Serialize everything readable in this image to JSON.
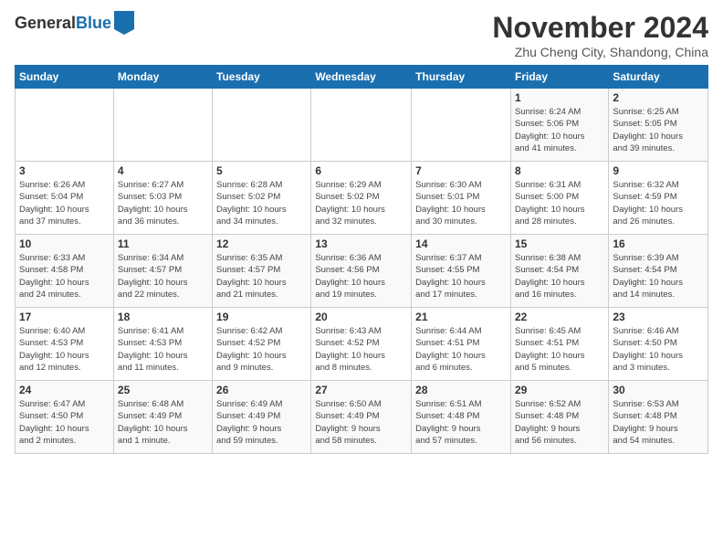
{
  "header": {
    "logo_general": "General",
    "logo_blue": "Blue",
    "month_title": "November 2024",
    "subtitle": "Zhu Cheng City, Shandong, China"
  },
  "days_of_week": [
    "Sunday",
    "Monday",
    "Tuesday",
    "Wednesday",
    "Thursday",
    "Friday",
    "Saturday"
  ],
  "weeks": [
    [
      {
        "day": "",
        "info": ""
      },
      {
        "day": "",
        "info": ""
      },
      {
        "day": "",
        "info": ""
      },
      {
        "day": "",
        "info": ""
      },
      {
        "day": "",
        "info": ""
      },
      {
        "day": "1",
        "info": "Sunrise: 6:24 AM\nSunset: 5:06 PM\nDaylight: 10 hours\nand 41 minutes."
      },
      {
        "day": "2",
        "info": "Sunrise: 6:25 AM\nSunset: 5:05 PM\nDaylight: 10 hours\nand 39 minutes."
      }
    ],
    [
      {
        "day": "3",
        "info": "Sunrise: 6:26 AM\nSunset: 5:04 PM\nDaylight: 10 hours\nand 37 minutes."
      },
      {
        "day": "4",
        "info": "Sunrise: 6:27 AM\nSunset: 5:03 PM\nDaylight: 10 hours\nand 36 minutes."
      },
      {
        "day": "5",
        "info": "Sunrise: 6:28 AM\nSunset: 5:02 PM\nDaylight: 10 hours\nand 34 minutes."
      },
      {
        "day": "6",
        "info": "Sunrise: 6:29 AM\nSunset: 5:02 PM\nDaylight: 10 hours\nand 32 minutes."
      },
      {
        "day": "7",
        "info": "Sunrise: 6:30 AM\nSunset: 5:01 PM\nDaylight: 10 hours\nand 30 minutes."
      },
      {
        "day": "8",
        "info": "Sunrise: 6:31 AM\nSunset: 5:00 PM\nDaylight: 10 hours\nand 28 minutes."
      },
      {
        "day": "9",
        "info": "Sunrise: 6:32 AM\nSunset: 4:59 PM\nDaylight: 10 hours\nand 26 minutes."
      }
    ],
    [
      {
        "day": "10",
        "info": "Sunrise: 6:33 AM\nSunset: 4:58 PM\nDaylight: 10 hours\nand 24 minutes."
      },
      {
        "day": "11",
        "info": "Sunrise: 6:34 AM\nSunset: 4:57 PM\nDaylight: 10 hours\nand 22 minutes."
      },
      {
        "day": "12",
        "info": "Sunrise: 6:35 AM\nSunset: 4:57 PM\nDaylight: 10 hours\nand 21 minutes."
      },
      {
        "day": "13",
        "info": "Sunrise: 6:36 AM\nSunset: 4:56 PM\nDaylight: 10 hours\nand 19 minutes."
      },
      {
        "day": "14",
        "info": "Sunrise: 6:37 AM\nSunset: 4:55 PM\nDaylight: 10 hours\nand 17 minutes."
      },
      {
        "day": "15",
        "info": "Sunrise: 6:38 AM\nSunset: 4:54 PM\nDaylight: 10 hours\nand 16 minutes."
      },
      {
        "day": "16",
        "info": "Sunrise: 6:39 AM\nSunset: 4:54 PM\nDaylight: 10 hours\nand 14 minutes."
      }
    ],
    [
      {
        "day": "17",
        "info": "Sunrise: 6:40 AM\nSunset: 4:53 PM\nDaylight: 10 hours\nand 12 minutes."
      },
      {
        "day": "18",
        "info": "Sunrise: 6:41 AM\nSunset: 4:53 PM\nDaylight: 10 hours\nand 11 minutes."
      },
      {
        "day": "19",
        "info": "Sunrise: 6:42 AM\nSunset: 4:52 PM\nDaylight: 10 hours\nand 9 minutes."
      },
      {
        "day": "20",
        "info": "Sunrise: 6:43 AM\nSunset: 4:52 PM\nDaylight: 10 hours\nand 8 minutes."
      },
      {
        "day": "21",
        "info": "Sunrise: 6:44 AM\nSunset: 4:51 PM\nDaylight: 10 hours\nand 6 minutes."
      },
      {
        "day": "22",
        "info": "Sunrise: 6:45 AM\nSunset: 4:51 PM\nDaylight: 10 hours\nand 5 minutes."
      },
      {
        "day": "23",
        "info": "Sunrise: 6:46 AM\nSunset: 4:50 PM\nDaylight: 10 hours\nand 3 minutes."
      }
    ],
    [
      {
        "day": "24",
        "info": "Sunrise: 6:47 AM\nSunset: 4:50 PM\nDaylight: 10 hours\nand 2 minutes."
      },
      {
        "day": "25",
        "info": "Sunrise: 6:48 AM\nSunset: 4:49 PM\nDaylight: 10 hours\nand 1 minute."
      },
      {
        "day": "26",
        "info": "Sunrise: 6:49 AM\nSunset: 4:49 PM\nDaylight: 9 hours\nand 59 minutes."
      },
      {
        "day": "27",
        "info": "Sunrise: 6:50 AM\nSunset: 4:49 PM\nDaylight: 9 hours\nand 58 minutes."
      },
      {
        "day": "28",
        "info": "Sunrise: 6:51 AM\nSunset: 4:48 PM\nDaylight: 9 hours\nand 57 minutes."
      },
      {
        "day": "29",
        "info": "Sunrise: 6:52 AM\nSunset: 4:48 PM\nDaylight: 9 hours\nand 56 minutes."
      },
      {
        "day": "30",
        "info": "Sunrise: 6:53 AM\nSunset: 4:48 PM\nDaylight: 9 hours\nand 54 minutes."
      }
    ]
  ]
}
